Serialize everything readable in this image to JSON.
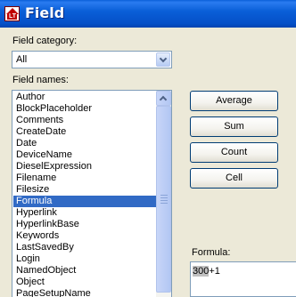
{
  "window": {
    "title": "Field"
  },
  "field_category": {
    "label": "Field category:",
    "selected": "All"
  },
  "field_names": {
    "label": "Field names:",
    "items": [
      "Author",
      "BlockPlaceholder",
      "Comments",
      "CreateDate",
      "Date",
      "DeviceName",
      "DieselExpression",
      "Filename",
      "Filesize",
      "Formula",
      "Hyperlink",
      "HyperlinkBase",
      "Keywords",
      "LastSavedBy",
      "Login",
      "NamedObject",
      "Object",
      "PageSetupName"
    ],
    "selected": "Formula"
  },
  "buttons": {
    "average": "Average",
    "sum": "Sum",
    "count": "Count",
    "cell": "Cell"
  },
  "formula": {
    "label": "Formula:",
    "selected_part": "300",
    "rest": "+1"
  },
  "colors": {
    "titlebar": "#0a5fd8",
    "selection": "#316ac5",
    "dialog_bg": "#ece9d8"
  }
}
